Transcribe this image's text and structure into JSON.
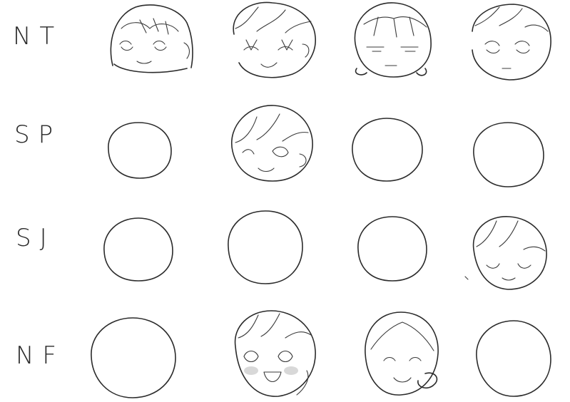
{
  "row_labels": {
    "nt": "NT",
    "sp": "SP",
    "sj": "SJ",
    "nf": "NF"
  }
}
